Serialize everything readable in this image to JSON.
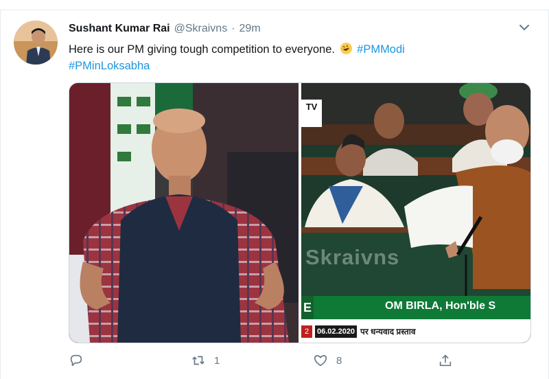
{
  "tweet": {
    "author_name": "Sushant Kumar Rai",
    "author_handle": "@Skraivns",
    "separator": "·",
    "time": "29m",
    "text_plain": "Here is our PM giving tough competition to everyone.",
    "hashtag_1": "#PMModi",
    "hashtag_2": "#PMinLoksabha",
    "emoji_icon": "rolling-on-floor-laughing-emoji"
  },
  "media": {
    "watermark": "Skraivns",
    "tv_logo": "TV",
    "ticker_name": "OM BIRLA, Hon'ble S",
    "ticker_letter": "E",
    "ticker_date": "06.02.2020",
    "ticker_num": "2",
    "ticker_hindi": "पर धन्यवाद प्रस्ताव"
  },
  "actions": {
    "reply_icon": "reply-icon",
    "retweet_count": "1",
    "like_count": "8",
    "share_icon": "share-icon"
  },
  "colors": {
    "link": "#1b95e0",
    "muted": "#657786",
    "ticker_green": "#0e7a36"
  }
}
